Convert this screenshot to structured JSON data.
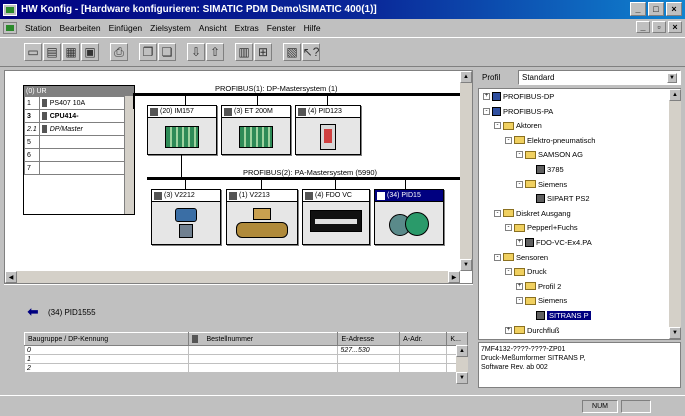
{
  "window": {
    "title": "HW Konfig - [Hardware konfigurieren: SIMATIC PDM Demo\\SIMATIC 400(1)]"
  },
  "menu": [
    "Station",
    "Bearbeiten",
    "Einfügen",
    "Zielsystem",
    "Ansicht",
    "Extras",
    "Fenster",
    "Hilfe"
  ],
  "station": {
    "rack_title": "(0) UR",
    "rack_rows": [
      {
        "slot": "1",
        "module": "PS407 10A"
      },
      {
        "slot": "3",
        "module": "CPU414-"
      },
      {
        "slot": "2.1",
        "module": "DP/Master"
      },
      {
        "slot": "5",
        "module": ""
      },
      {
        "slot": "6",
        "module": ""
      },
      {
        "slot": "7",
        "module": ""
      }
    ],
    "bus1": {
      "label": "PROFIBUS(1): DP-Mastersystem (1)",
      "devices": [
        "(20) IM157",
        "(3) ET 200M",
        "(4) PID123"
      ]
    },
    "bus2": {
      "label": "PROFIBUS(2): PA-Mastersystem (5990)",
      "devices": [
        "(3) V2212",
        "(1) V2213",
        "(4) FDO VC",
        "(34) PID15"
      ]
    }
  },
  "detail": {
    "title": "(34)  PID1555",
    "columns": [
      "Baugruppe / DP-Kennung",
      "Bestellnummer",
      "E-Adresse",
      "A-Adr.",
      "K..."
    ],
    "rows": [
      {
        "num": "0",
        "eaddr": "527...530"
      },
      {
        "num": "1",
        "eaddr": ""
      },
      {
        "num": "2",
        "eaddr": ""
      }
    ]
  },
  "catalog": {
    "profile_label": "Profil",
    "profile_value": "Standard",
    "tree": [
      {
        "label": "PROFIBUS-DP",
        "level": 0,
        "type": "root",
        "exp": "+"
      },
      {
        "label": "PROFIBUS-PA",
        "level": 0,
        "type": "root",
        "exp": "-"
      },
      {
        "label": "Aktoren",
        "level": 1,
        "type": "folder",
        "exp": "-"
      },
      {
        "label": "Elektro-pneumatisch",
        "level": 2,
        "type": "folder",
        "exp": "-"
      },
      {
        "label": "SAMSON AG",
        "level": 3,
        "type": "folder",
        "exp": "-"
      },
      {
        "label": "3785",
        "level": 4,
        "type": "device",
        "exp": ""
      },
      {
        "label": "Siemens",
        "level": 3,
        "type": "folder",
        "exp": "-"
      },
      {
        "label": "SIPART PS2",
        "level": 4,
        "type": "device",
        "exp": ""
      },
      {
        "label": "Diskret Ausgang",
        "level": 1,
        "type": "folder",
        "exp": "-"
      },
      {
        "label": "Pepperl+Fuchs",
        "level": 2,
        "type": "folder",
        "exp": "-"
      },
      {
        "label": "FDO-VC-Ex4.PA",
        "level": 3,
        "type": "device",
        "exp": "+"
      },
      {
        "label": "Sensoren",
        "level": 1,
        "type": "folder",
        "exp": "-"
      },
      {
        "label": "Druck",
        "level": 2,
        "type": "folder",
        "exp": "-"
      },
      {
        "label": "Profil 2",
        "level": 3,
        "type": "folder",
        "exp": "+"
      },
      {
        "label": "Siemens",
        "level": 3,
        "type": "folder",
        "exp": "-"
      },
      {
        "label": "SITRANS P",
        "level": 4,
        "type": "device",
        "exp": "",
        "selected": true
      },
      {
        "label": "Durchfluß",
        "level": 2,
        "type": "folder",
        "exp": "+"
      }
    ],
    "info": [
      "7MF4132-????-????-ZP01",
      "Druck-Meßumformer SITRANS P,",
      "Software Rev. ab 002"
    ]
  },
  "status": {
    "num": "NUM"
  },
  "colors": {
    "title_bg": "#000080",
    "selection": "#000080"
  }
}
